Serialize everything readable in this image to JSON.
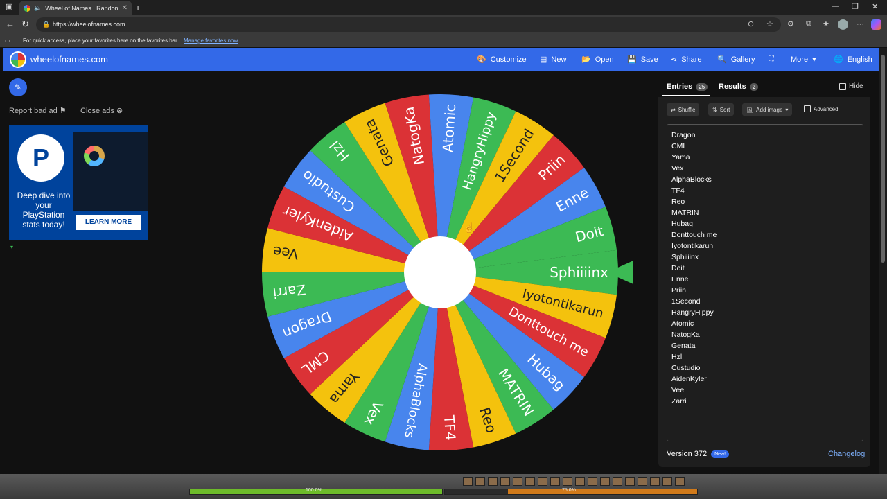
{
  "browser": {
    "tab_title": "Wheel of Names | Random n",
    "url": "https://wheelofnames.com",
    "favorites_hint": "For quick access, place your favorites here on the favorites bar.",
    "favorites_link": "Manage favorites now"
  },
  "header": {
    "site_name": "wheelofnames.com",
    "menu": [
      "Customize",
      "New",
      "Open",
      "Save",
      "Share",
      "Gallery",
      "More",
      "English"
    ]
  },
  "ads": {
    "report": "Report bad ad",
    "close": "Close ads",
    "text": "Deep dive into your PlayStation stats today!",
    "button": "LEARN MORE"
  },
  "wheel": {
    "segments": [
      "Sphiiiinx",
      "Iyotontikarun",
      "Donttouch me",
      "Hubag",
      "MATRIN",
      "Reo",
      "TF4",
      "AlphaBlocks",
      "Vex",
      "Yama",
      "CML",
      "Dragon",
      "Zarri",
      "Vee",
      "AidenKyler",
      "Custudio",
      "Hzl",
      "Genata",
      "NatogKa",
      "Atomic",
      "HangryHippy",
      "1Second",
      "Priin",
      "Enne",
      "Doit"
    ],
    "colors": [
      "#3cba54",
      "#f4c20d",
      "#db3236",
      "#4885ed"
    ]
  },
  "sidebar": {
    "entries_tab": "Entries",
    "entries_count": "25",
    "results_tab": "Results",
    "results_count": "2",
    "hide": "Hide",
    "shuffle": "Shuffle",
    "sort": "Sort",
    "add_image": "Add image",
    "advanced": "Advanced",
    "entries": [
      "Dragon",
      "CML",
      "Yama",
      "Vex",
      "AlphaBlocks",
      "TF4",
      "Reo",
      "MATRIN",
      "Hubag",
      "Donttouch me",
      "Iyotontikarun",
      "Sphiiiinx",
      "Doit",
      "Enne",
      "Priin",
      "1Second",
      "HangryHippy",
      "Atomic",
      "NatogKa",
      "Genata",
      "Hzl",
      "Custudio",
      "AidenKyler",
      "Vee",
      "Zarri"
    ],
    "version": "Version 372",
    "new_badge": "New!",
    "changelog": "Changelog"
  },
  "game": {
    "health": "100.0%",
    "resource": "75.0%"
  }
}
